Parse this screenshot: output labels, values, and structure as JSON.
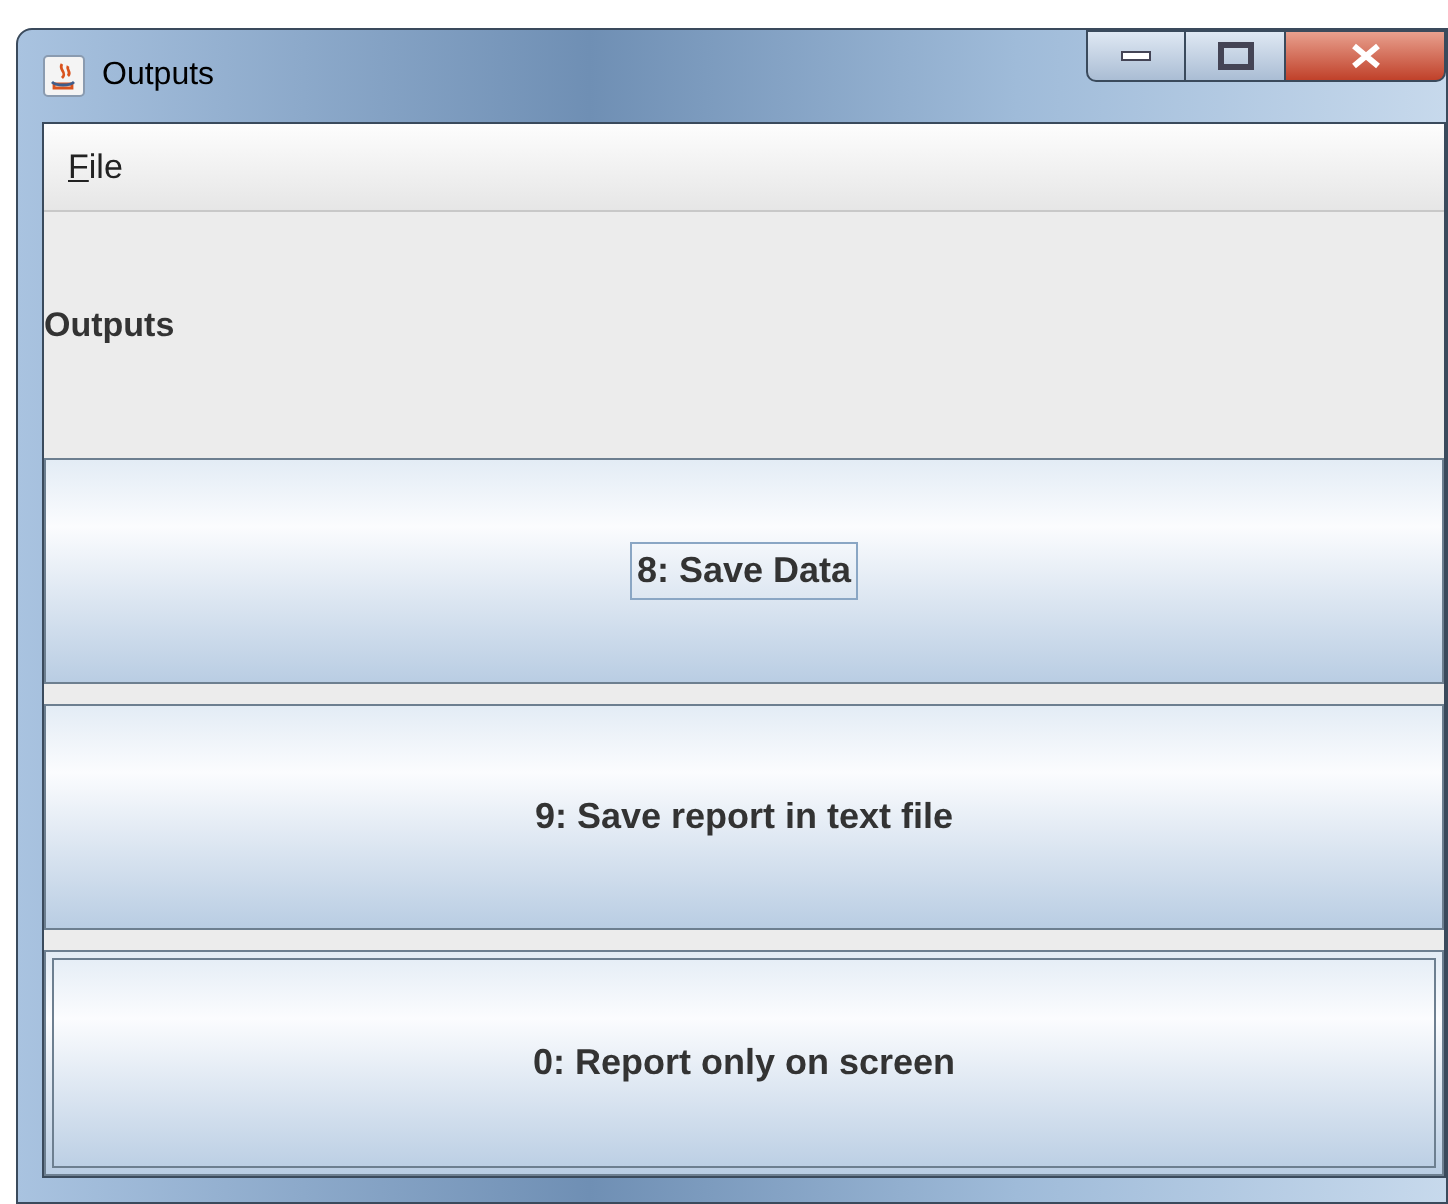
{
  "window": {
    "title": "Outputs"
  },
  "menu": [
    {
      "mnemonic": "F",
      "rest": "ile"
    }
  ],
  "heading": "Outputs",
  "buttons": [
    {
      "label": "8: Save Data",
      "focused": true,
      "default": false
    },
    {
      "label": "9: Save report in text file",
      "focused": false,
      "default": false
    },
    {
      "label": "0: Report only on screen",
      "focused": false,
      "default": true
    }
  ]
}
